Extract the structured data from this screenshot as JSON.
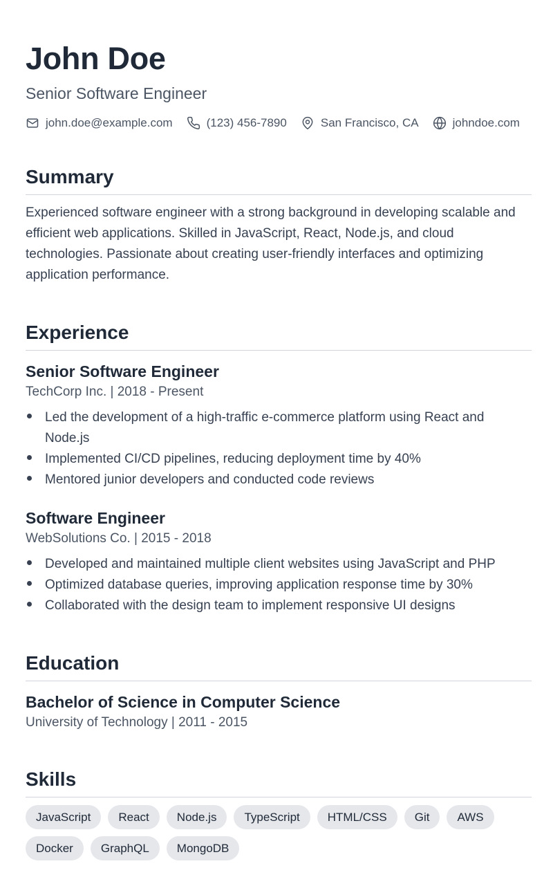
{
  "header": {
    "name": "John Doe",
    "title": "Senior Software Engineer",
    "contacts": [
      {
        "icon": "mail-icon",
        "text": "john.doe@example.com"
      },
      {
        "icon": "phone-icon",
        "text": "(123) 456-7890"
      },
      {
        "icon": "location-pin-icon",
        "text": "San Francisco, CA"
      },
      {
        "icon": "globe-icon",
        "text": "johndoe.com"
      }
    ]
  },
  "summary": {
    "heading": "Summary",
    "text": "Experienced software engineer with a strong background in developing scalable and efficient web applications. Skilled in JavaScript, React, Node.js, and cloud technologies. Passionate about creating user-friendly interfaces and optimizing application performance."
  },
  "experience": {
    "heading": "Experience",
    "jobs": [
      {
        "title": "Senior Software Engineer",
        "meta": "TechCorp Inc. | 2018 - Present",
        "bullets": [
          "Led the development of a high-traffic e-commerce platform using React and Node.js",
          "Implemented CI/CD pipelines, reducing deployment time by 40%",
          "Mentored junior developers and conducted code reviews"
        ]
      },
      {
        "title": "Software Engineer",
        "meta": "WebSolutions Co. | 2015 - 2018",
        "bullets": [
          "Developed and maintained multiple client websites using JavaScript and PHP",
          "Optimized database queries, improving application response time by 30%",
          "Collaborated with the design team to implement responsive UI designs"
        ]
      }
    ]
  },
  "education": {
    "heading": "Education",
    "degree": "Bachelor of Science in Computer Science",
    "meta": "University of Technology | 2011 - 2015"
  },
  "skills": {
    "heading": "Skills",
    "items": [
      "JavaScript",
      "React",
      "Node.js",
      "TypeScript",
      "HTML/CSS",
      "Git",
      "AWS",
      "Docker",
      "GraphQL",
      "MongoDB"
    ]
  },
  "colors": {
    "text": "#1f2937",
    "muted": "#4b5563",
    "chip_bg": "#e5e7eb",
    "divider": "#d1d5db"
  }
}
